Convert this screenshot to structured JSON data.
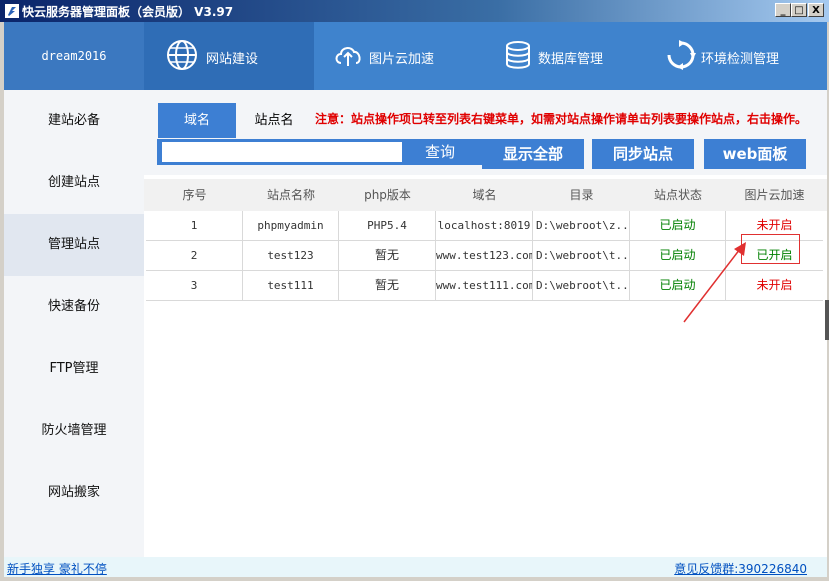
{
  "window": {
    "title": "快云服务器管理面板（会员版） V3.97",
    "controls": [
      "_",
      "□",
      "X"
    ]
  },
  "user": {
    "name": "dream2016"
  },
  "topnav": [
    {
      "label": "网站建设",
      "icon": "globe-icon",
      "active": true
    },
    {
      "label": "图片云加速",
      "icon": "cloud-upload-icon",
      "active": false
    },
    {
      "label": "数据库管理",
      "icon": "database-icon",
      "active": false
    },
    {
      "label": "环境检测管理",
      "icon": "refresh-icon",
      "active": false
    }
  ],
  "sidebar": [
    {
      "label": "建站必备"
    },
    {
      "label": "创建站点"
    },
    {
      "label": "管理站点",
      "active": true
    },
    {
      "label": "快速备份"
    },
    {
      "label": "FTP管理"
    },
    {
      "label": "防火墙管理"
    },
    {
      "label": "网站搬家"
    }
  ],
  "tabs": [
    {
      "label": "域名",
      "active": true
    },
    {
      "label": "站点名",
      "active": false
    }
  ],
  "notice": "注意：站点操作项已转至列表右键菜单，如需对站点操作请单击列表要操作站点，右击操作。",
  "search": {
    "value": "",
    "placeholder": "",
    "button": "查询"
  },
  "buttons": {
    "show_all": "显示全部",
    "sync": "同步站点",
    "web_panel": "web面板"
  },
  "table": {
    "columns": [
      "序号",
      "站点名称",
      "php版本",
      "域名",
      "目录",
      "站点状态",
      "图片云加速"
    ],
    "rows": [
      {
        "no": "1",
        "name": "phpmyadmin",
        "php": "PHP5.4",
        "domain": "localhost:8019",
        "dir": "D:\\webroot\\z...",
        "status": "已启动",
        "cdn": "未开启"
      },
      {
        "no": "2",
        "name": "test123",
        "php": "暂无",
        "domain": "www.test123.com",
        "dir": "D:\\webroot\\t...",
        "status": "已启动",
        "cdn": "已开启"
      },
      {
        "no": "3",
        "name": "test111",
        "php": "暂无",
        "domain": "www.test111.com",
        "dir": "D:\\webroot\\t...",
        "status": "已启动",
        "cdn": "未开启"
      }
    ]
  },
  "statusbar": {
    "left_link": "新手独享 豪礼不停",
    "right_link": "意见反馈群:390226840"
  },
  "colors": {
    "nav_blue": "#3f83cd",
    "button_blue": "#3d7fd3",
    "status_green": "#008000",
    "warn_red": "#e00000"
  }
}
